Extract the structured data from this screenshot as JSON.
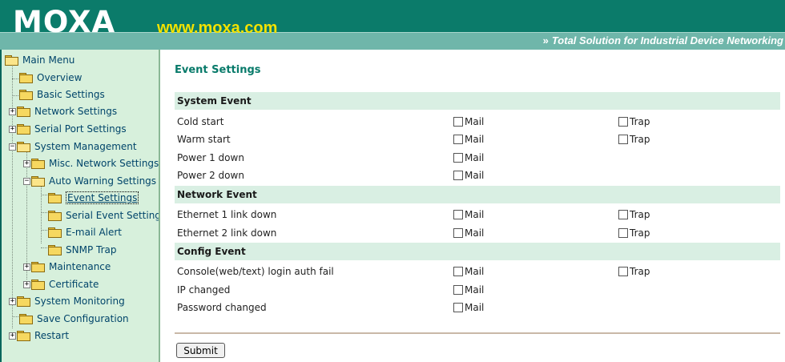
{
  "header": {
    "logo": "MOXA",
    "url": "www.moxa.com",
    "tagline": "Total Solution for Industrial Device Networking",
    "tagline_icon": "double-chevron-right-icon"
  },
  "sidebar": {
    "items": [
      {
        "label": "Main Menu"
      },
      {
        "label": "Overview"
      },
      {
        "label": "Basic Settings"
      },
      {
        "label": "Network Settings"
      },
      {
        "label": "Serial Port Settings"
      },
      {
        "label": "System Management"
      },
      {
        "label": "Misc. Network Settings"
      },
      {
        "label": "Auto Warning Settings"
      },
      {
        "label": "Event Settings"
      },
      {
        "label": "Serial Event Settings"
      },
      {
        "label": "E-mail Alert"
      },
      {
        "label": "SNMP Trap"
      },
      {
        "label": "Maintenance"
      },
      {
        "label": "Certificate"
      },
      {
        "label": "System Monitoring"
      },
      {
        "label": "Save Configuration"
      },
      {
        "label": "Restart"
      }
    ],
    "expander_plus": "+",
    "expander_minus": "−"
  },
  "main": {
    "title": "Event Settings",
    "sections": [
      {
        "title": "System Event",
        "rows": [
          {
            "label": "Cold start",
            "mail": "Mail",
            "trap": "Trap"
          },
          {
            "label": "Warm start",
            "mail": "Mail",
            "trap": "Trap"
          },
          {
            "label": "Power 1 down",
            "mail": "Mail"
          },
          {
            "label": "Power 2 down",
            "mail": "Mail"
          }
        ]
      },
      {
        "title": "Network Event",
        "rows": [
          {
            "label": "Ethernet 1 link down",
            "mail": "Mail",
            "trap": "Trap"
          },
          {
            "label": "Ethernet 2 link down",
            "mail": "Mail",
            "trap": "Trap"
          }
        ]
      },
      {
        "title": "Config Event",
        "rows": [
          {
            "label": "Console(web/text) login auth fail",
            "mail": "Mail",
            "trap": "Trap"
          },
          {
            "label": "IP changed",
            "mail": "Mail"
          },
          {
            "label": "Password changed",
            "mail": "Mail"
          }
        ]
      }
    ],
    "submit_label": "Submit"
  },
  "colors": {
    "header_bg": "#0b7b6a",
    "header_band": "#6fb6aa",
    "url_color": "#f3e200",
    "sidebar_bg": "#d7f0dc",
    "section_bg": "#d9efe3",
    "title_color": "#087a6a"
  }
}
